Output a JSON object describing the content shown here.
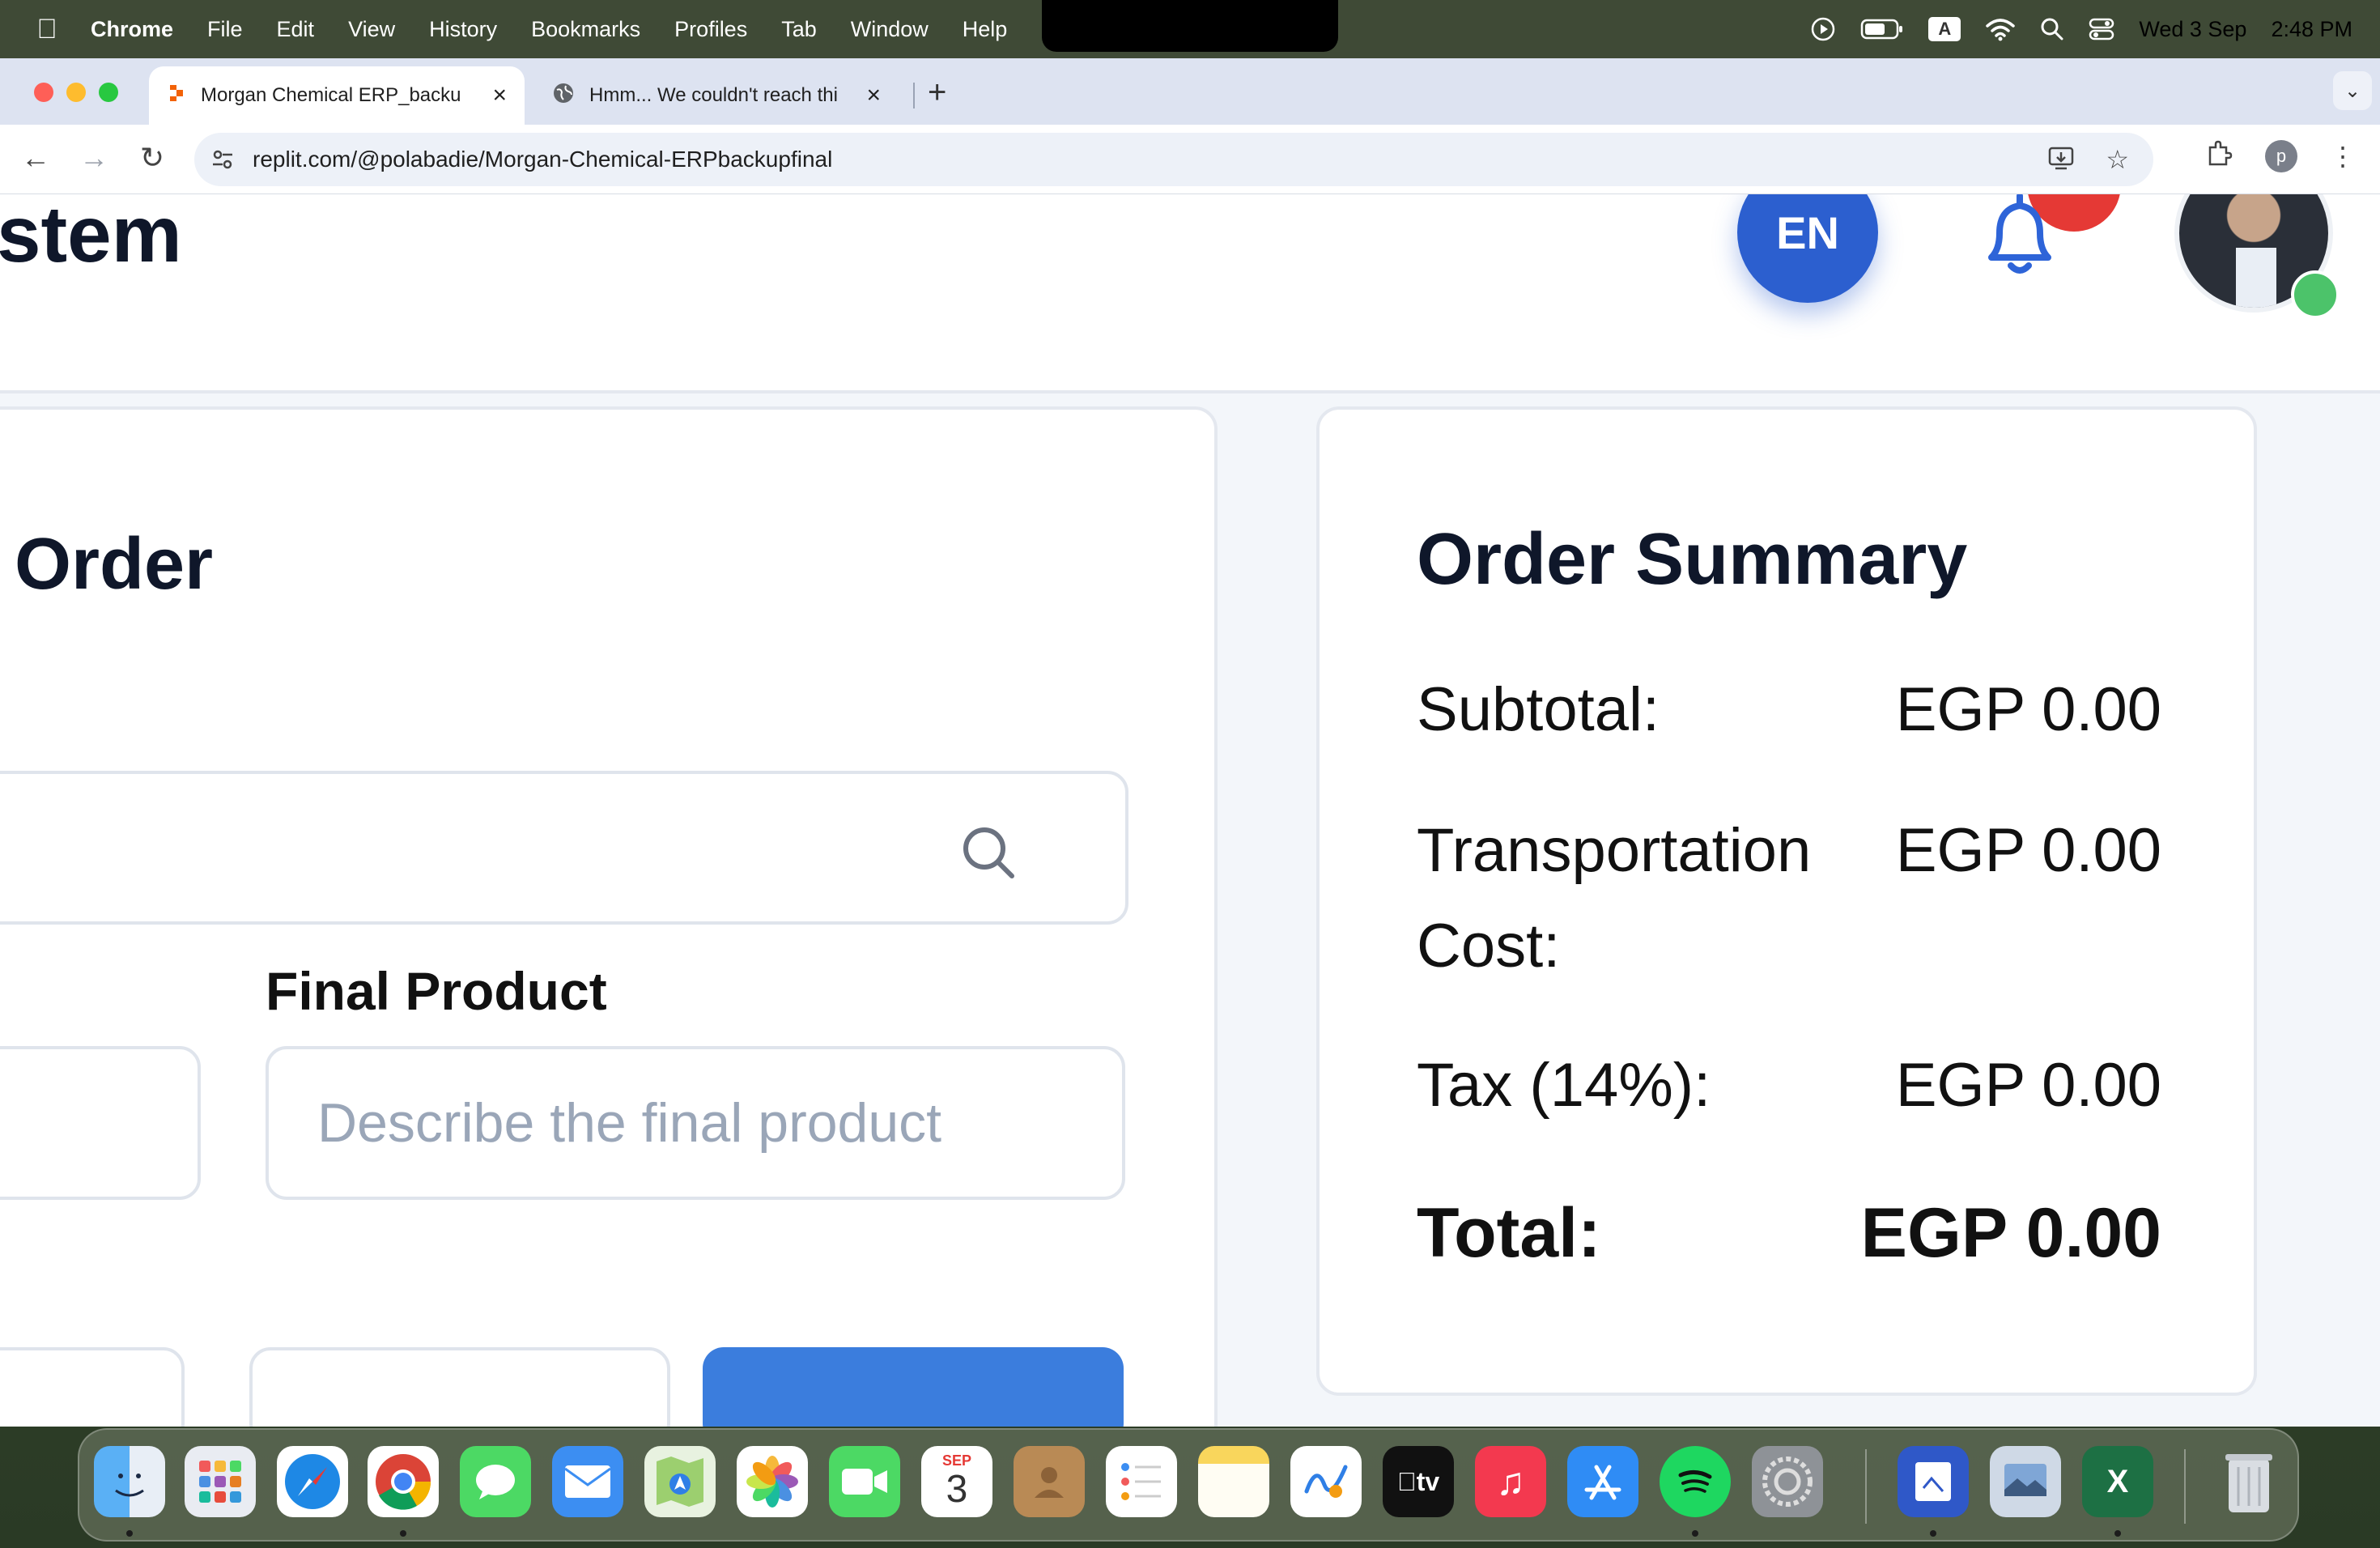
{
  "menubar": {
    "app": "Chrome",
    "items": [
      "File",
      "Edit",
      "View",
      "History",
      "Bookmarks",
      "Profiles",
      "Tab",
      "Window",
      "Help"
    ],
    "keyboard_input": "A",
    "date": "Wed 3 Sep",
    "time": "2:48 PM"
  },
  "browser": {
    "tabs": [
      {
        "title": "Morgan Chemical ERP_backu",
        "icon": "replit-icon",
        "active": true
      },
      {
        "title": "Hmm... We couldn't reach thi",
        "icon": "globe-icon",
        "active": false
      }
    ],
    "url": "replit.com/@polabadie/Morgan-Chemical-ERPbackupfinal",
    "profile_initial": "p"
  },
  "page": {
    "header": {
      "title_fragment": "stem",
      "language": "EN"
    },
    "order_form": {
      "heading_fragment": "Order",
      "final_product_label": "Final Product",
      "final_product_placeholder": "Describe the final product"
    },
    "summary": {
      "title": "Order Summary",
      "rows": [
        {
          "label": "Subtotal:",
          "value": "EGP 0.00"
        },
        {
          "label": "Transportation Cost:",
          "value": "EGP 0.00"
        },
        {
          "label": "Tax (14%):",
          "value": "EGP 0.00"
        }
      ],
      "total_label": "Total:",
      "total_value": "EGP 0.00"
    }
  },
  "dock": {
    "calendar_month": "SEP",
    "calendar_day": "3",
    "apps": [
      "finder",
      "launchpad",
      "safari",
      "chrome",
      "messages",
      "mail",
      "maps",
      "photos",
      "facetime",
      "calendar",
      "contacts",
      "reminders",
      "notes",
      "freeform",
      "tv",
      "music",
      "app-store",
      "spotify",
      "system-settings",
      "preview",
      "photo-library",
      "excel",
      "trash"
    ]
  }
}
